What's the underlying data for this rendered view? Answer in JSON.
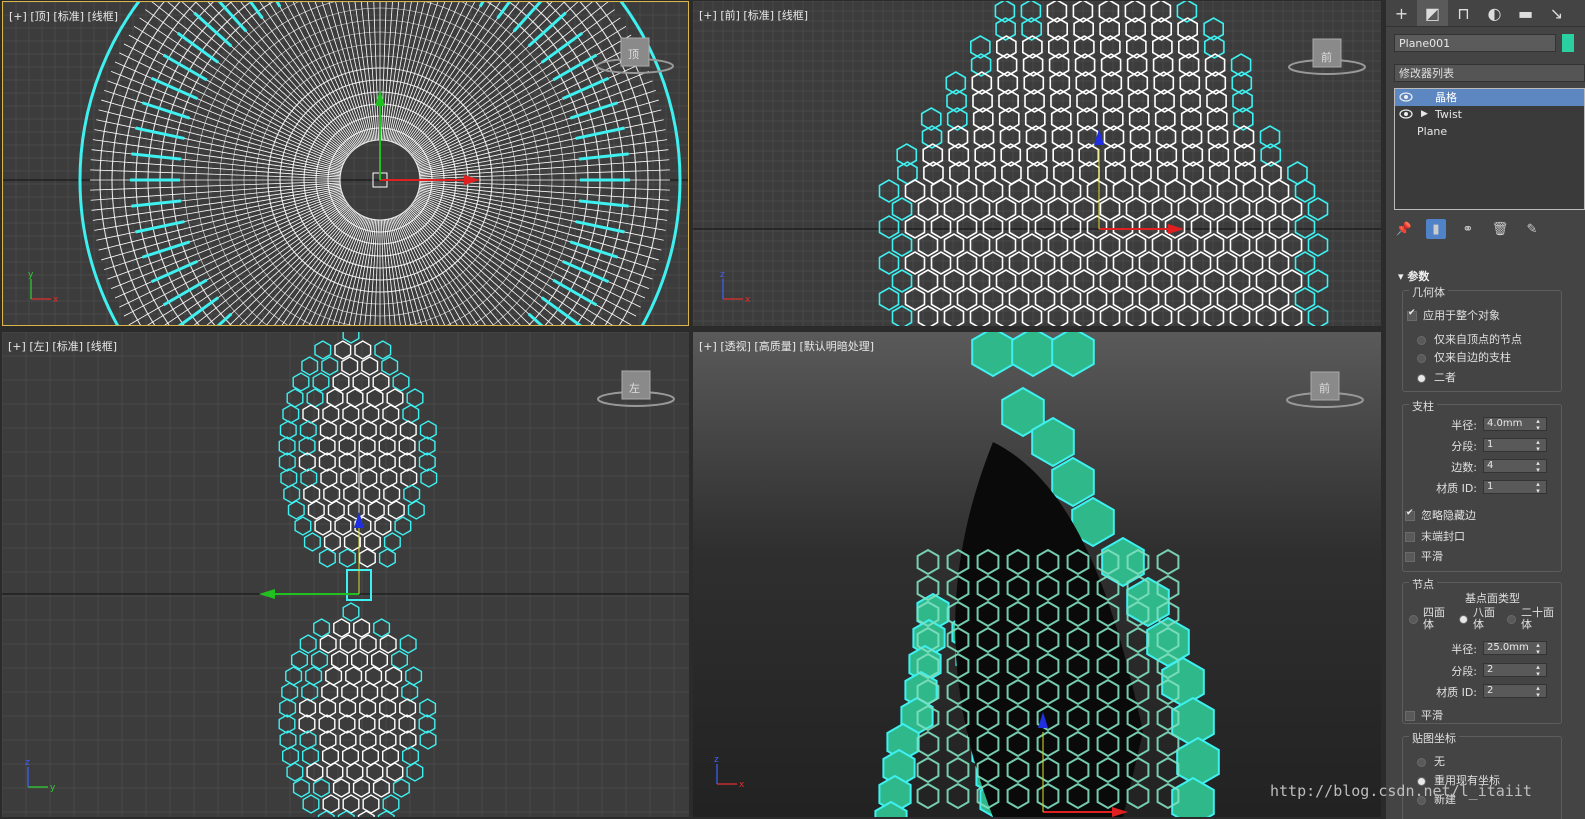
{
  "viewports": {
    "top": {
      "plus": "[+]",
      "view": "[顶]",
      "shading": "[标准]",
      "mode": "[线框]",
      "cube": "顶"
    },
    "front": {
      "plus": "[+]",
      "view": "[前]",
      "shading": "[标准]",
      "mode": "[线框]",
      "cube": "前"
    },
    "left": {
      "plus": "[+]",
      "view": "[左]",
      "shading": "[标准]",
      "mode": "[线框]",
      "cube": "左"
    },
    "persp": {
      "plus": "[+]",
      "view": "[透视]",
      "shading": "[高质量]",
      "mode": "[默认明暗处理]",
      "cube": "前"
    }
  },
  "axis": {
    "x": "x",
    "y": "y",
    "z": "z"
  },
  "panel": {
    "object_name": "Plane001",
    "object_color": "#2bd0a0",
    "modifier_list": "修改器列表",
    "stack": [
      {
        "label": "晶格",
        "selected": true,
        "eye": true,
        "expand": false
      },
      {
        "label": "Twist",
        "selected": false,
        "eye": true,
        "expand": true
      },
      {
        "label": "Plane",
        "selected": false,
        "eye": false,
        "expand": false
      }
    ],
    "rollout_title": "参数",
    "geometry": {
      "title": "几何体",
      "apply_all": "应用于整个对象",
      "opt_joints": "仅来自顶点的节点",
      "opt_struts": "仅来自边的支柱",
      "opt_both": "二者"
    },
    "struts": {
      "title": "支柱",
      "radius_label": "半径:",
      "radius": "4.0mm",
      "segments_label": "分段:",
      "segments": "1",
      "sides_label": "边数:",
      "sides": "4",
      "matid_label": "材质 ID:",
      "matid": "1",
      "ignore_hidden": "忽略隐藏边",
      "end_caps": "末端封口",
      "smooth": "平滑"
    },
    "joints": {
      "title": "节点",
      "base_type": "基点面类型",
      "tetra": "四面体",
      "octa": "八面体",
      "icosa": "二十面体",
      "radius_label": "半径:",
      "radius": "25.0mm",
      "segments_label": "分段:",
      "segments": "2",
      "matid_label": "材质 ID:",
      "matid": "2",
      "smooth": "平滑"
    },
    "mapping": {
      "title": "贴图坐标",
      "none": "无",
      "reuse": "重用现有坐标",
      "new": "新建"
    }
  },
  "watermark": "http://blog.csdn.net/l_itaiit",
  "colors": {
    "wire": "#ffffff",
    "cyan": "#3ff0f0",
    "teal": "#2fb88a",
    "select_border": "#d9b54a"
  }
}
